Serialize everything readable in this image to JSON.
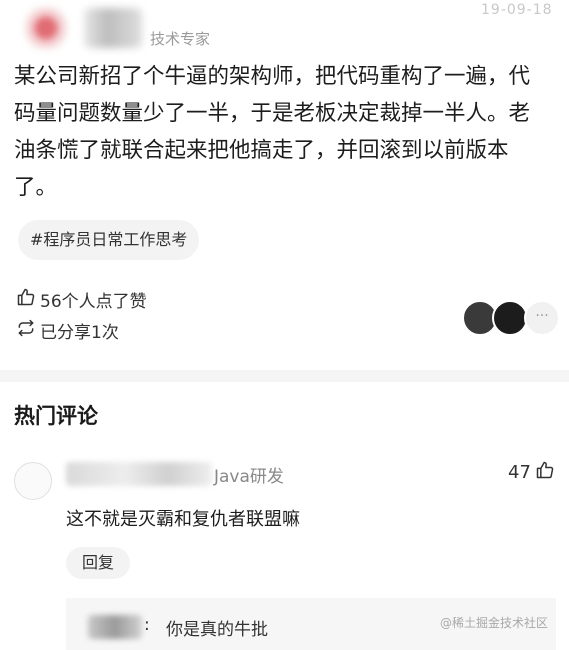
{
  "header": {
    "role": "技术专家",
    "date": "19-09-18"
  },
  "post": {
    "text": "某公司新招了个牛逼的架构师，把代码重构了一遍，代码量问题数量少了一半，于是老板决定裁掉一半人。老油条慌了就联合起来把他搞走了，并回滚到以前版本了。",
    "tag": "#程序员日常工作思考"
  },
  "stats": {
    "likes_text": "56个人点了赞",
    "shares_text": "已分享1次",
    "more_label": "···"
  },
  "comments": {
    "section_title": "热门评论",
    "items": [
      {
        "author_suffix": "Java研发",
        "like_count": "47",
        "text": "这不就是灭霸和复仇者联盟嘛",
        "reply_label": "回复",
        "sub_reply": {
          "colon": ":",
          "text": "你是真的牛批"
        }
      }
    ]
  },
  "watermark": "@稀土掘金技术社区",
  "icons": {
    "like": "thumbs-up-icon",
    "share": "share-icon"
  }
}
